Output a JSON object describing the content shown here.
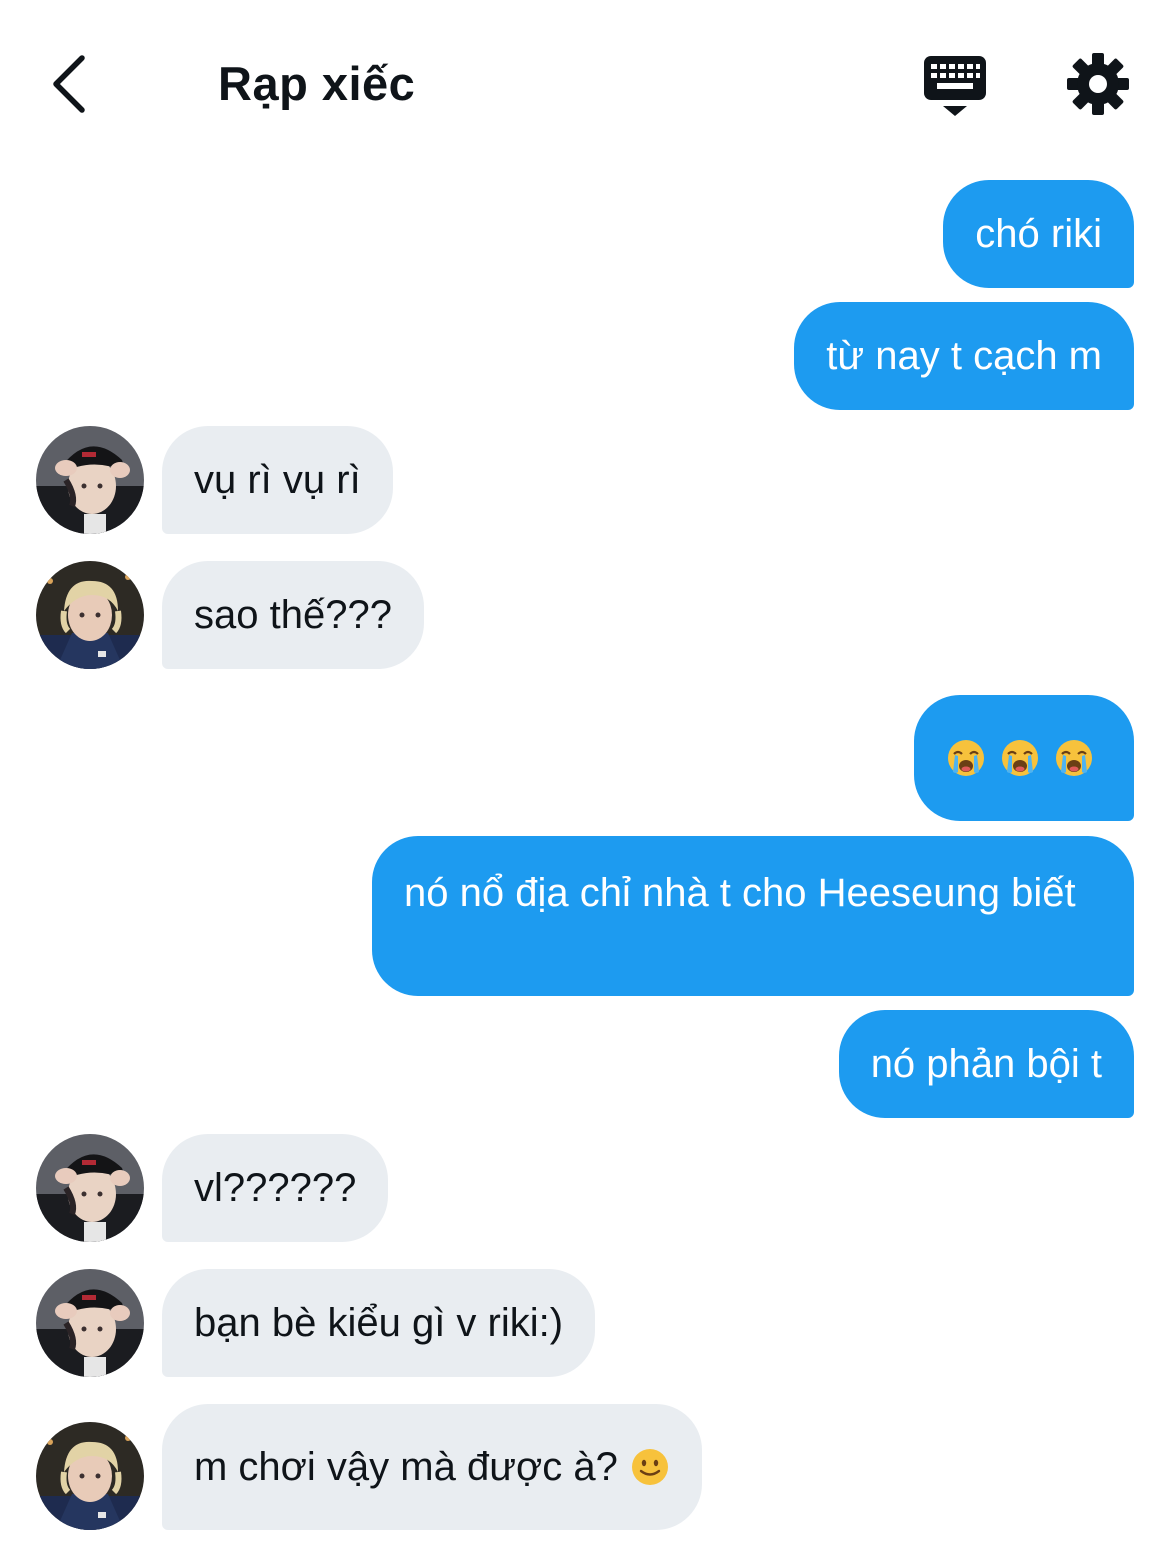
{
  "header": {
    "title": "Rạp xiếc",
    "back_icon": "chevron-left-icon",
    "keyboard_icon": "keyboard-icon",
    "settings_icon": "gear-icon"
  },
  "colors": {
    "sent_bubble": "#1d9bf0",
    "received_bubble": "#e9edf1",
    "text": "#0f1419"
  },
  "messages": [
    {
      "direction": "sent",
      "text": "chó riki"
    },
    {
      "direction": "sent",
      "text": "từ nay t cạch m"
    },
    {
      "direction": "received",
      "sender": "avatar-cap",
      "text": "vụ rì vụ rì"
    },
    {
      "direction": "received",
      "sender": "avatar-blond",
      "text": "sao thế???"
    },
    {
      "direction": "sent",
      "text": "",
      "emoji": [
        "loudly-crying-face",
        "loudly-crying-face",
        "loudly-crying-face"
      ]
    },
    {
      "direction": "sent",
      "text": "nó nổ địa chỉ nhà t cho Heeseung biết"
    },
    {
      "direction": "sent",
      "text": "nó phản bội t"
    },
    {
      "direction": "received",
      "sender": "avatar-cap",
      "text": "vl??????"
    },
    {
      "direction": "received",
      "sender": "avatar-cap",
      "text": "bạn bè kiểu gì v riki:)"
    },
    {
      "direction": "received",
      "sender": "avatar-blond",
      "text": "m chơi vậy mà được à?",
      "emoji": [
        "slightly-smiling-face"
      ]
    }
  ]
}
